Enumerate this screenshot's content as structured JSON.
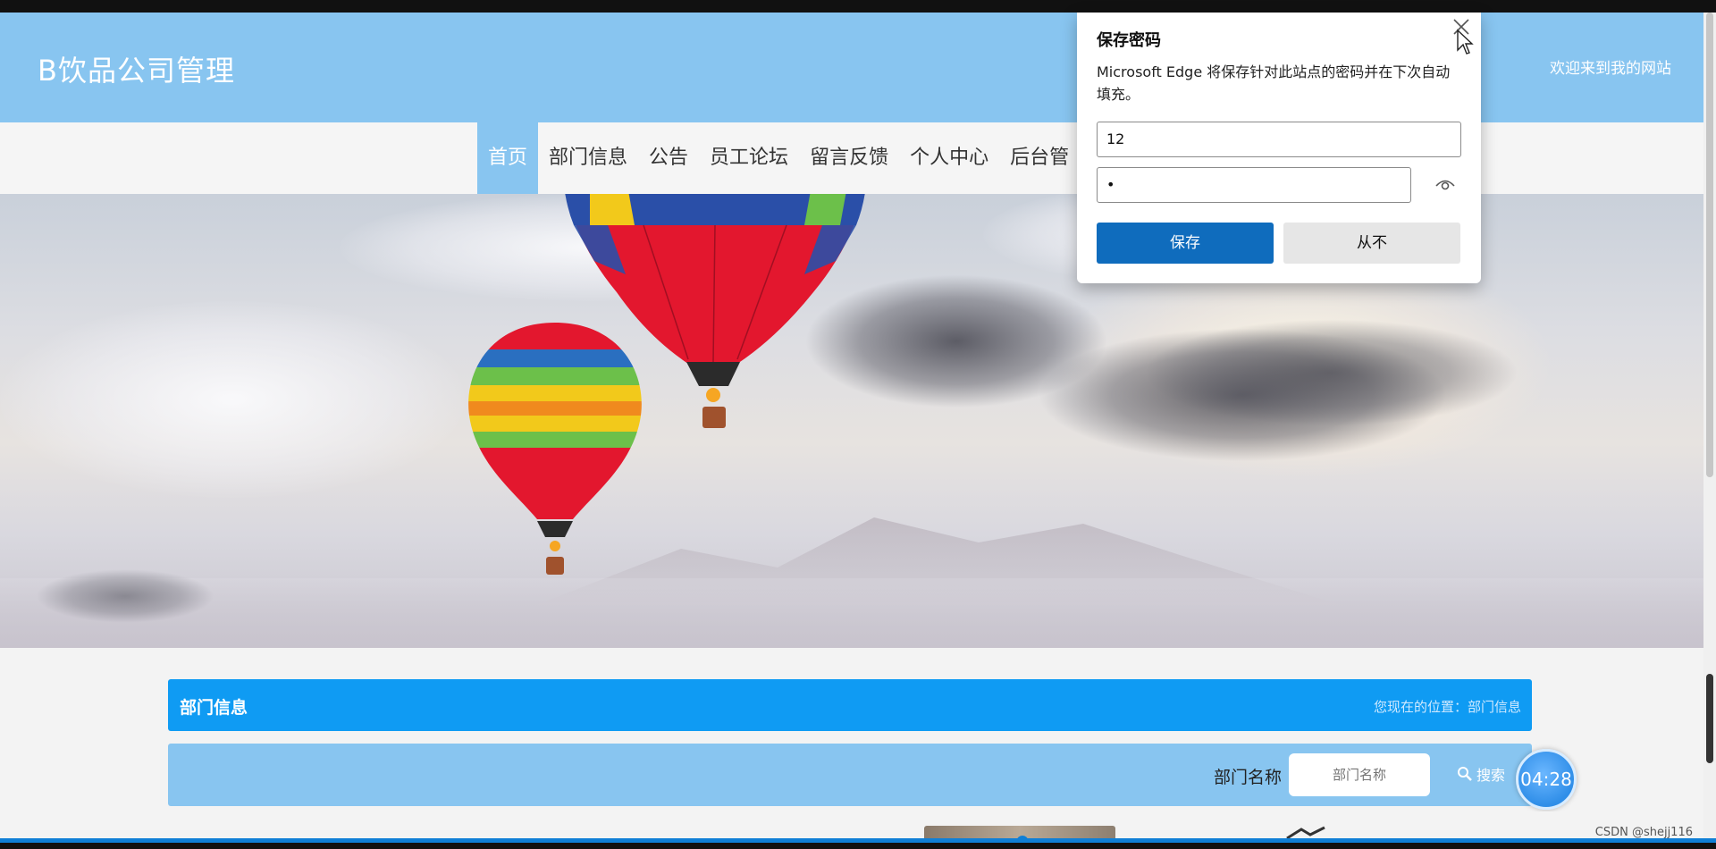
{
  "header": {
    "site_title": "B饮品公司管理",
    "welcome": "欢迎来到我的网站"
  },
  "nav": {
    "items": [
      {
        "label": "首页",
        "active": true
      },
      {
        "label": "部门信息"
      },
      {
        "label": "公告"
      },
      {
        "label": "员工论坛"
      },
      {
        "label": "留言反馈"
      },
      {
        "label": "个人中心"
      },
      {
        "label": "后台管"
      }
    ]
  },
  "carousel": {
    "slides_total": 3,
    "active_slide": 1
  },
  "panel": {
    "title": "部门信息",
    "location": "您现在的位置：部门信息"
  },
  "search": {
    "label": "部门名称",
    "placeholder": "部门名称",
    "button": "搜索"
  },
  "timer": "04:28",
  "watermark": "CSDN @shejj116",
  "save_password_popup": {
    "title": "保存密码",
    "description": "Microsoft Edge 将保存针对此站点的密码并在下次自动填充。",
    "username_value": "12",
    "password_value": "•",
    "save_button": "保存",
    "never_button": "从不"
  },
  "colors": {
    "header_bg": "#88c5f0",
    "panel_title_bg": "#0f9bf3",
    "edge_primary": "#0f6cbd"
  }
}
